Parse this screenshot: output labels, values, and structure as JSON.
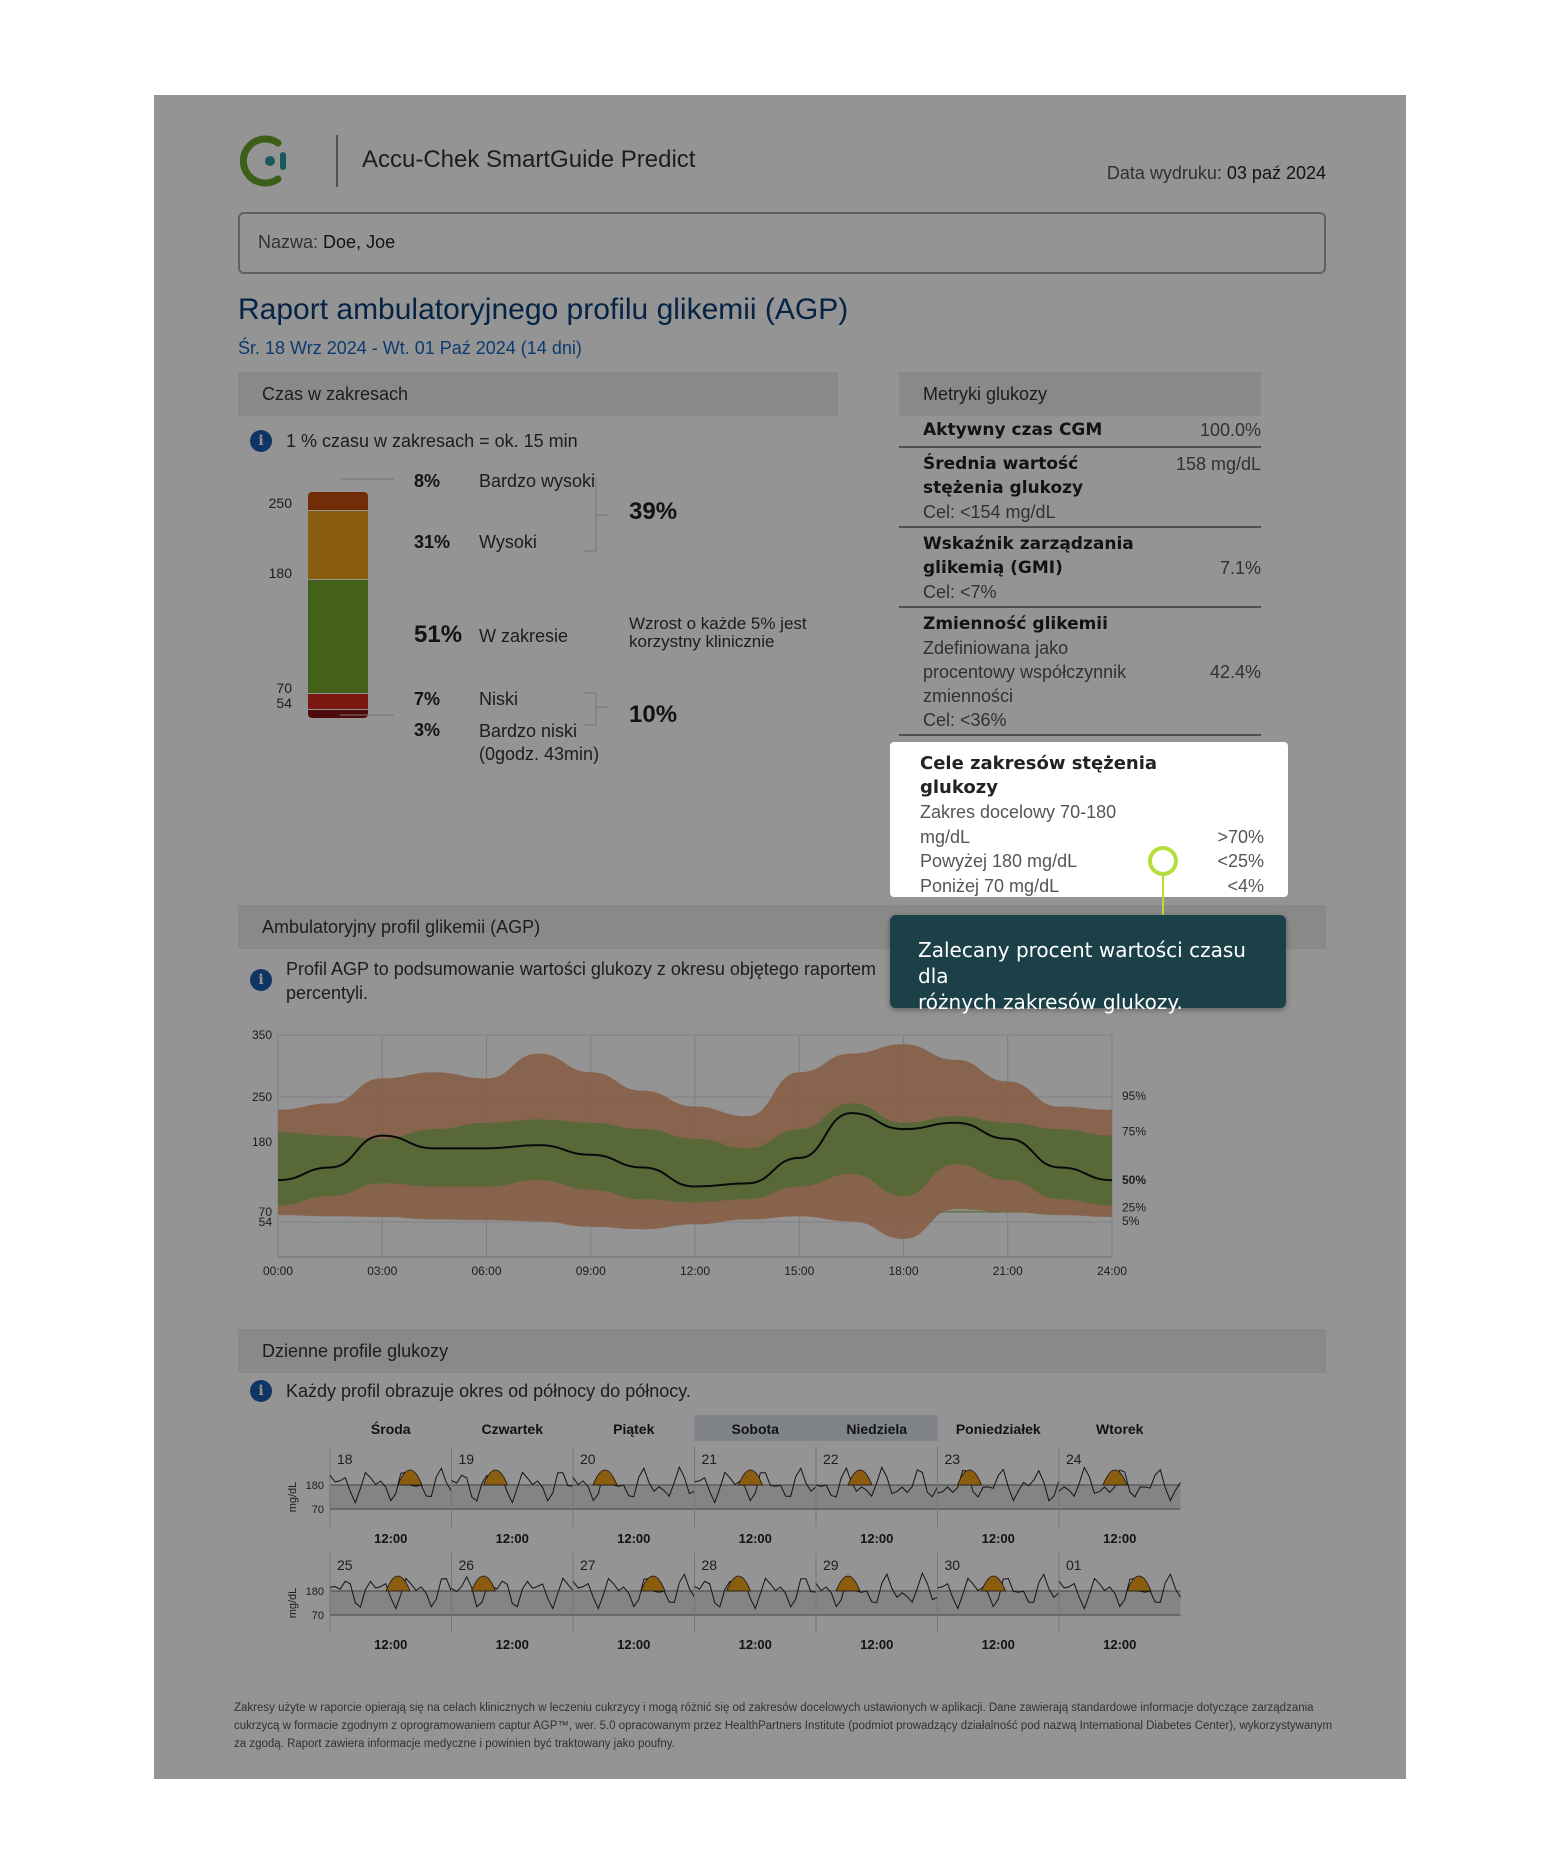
{
  "header": {
    "app_title": "Accu-Chek SmartGuide Predict",
    "print_date_label": "Data wydruku:",
    "print_date_value": "03 paź 2024",
    "name_label": "Nazwa:",
    "name_value": "Doe, Joe"
  },
  "report": {
    "title": "Raport ambulatoryjnego profilu glikemii (AGP)",
    "date_range": "Śr. 18 Wrz 2024 - Wt. 01 Paź 2024 (14 dni)"
  },
  "time_in_ranges": {
    "header": "Czas w zakresach",
    "note": "1 % czasu w zakresach = ok. 15 min",
    "axis_ticks": [
      "250",
      "180",
      "70",
      "54"
    ],
    "ranges": [
      {
        "pct": "8%",
        "label": "Bardzo wysoki",
        "value": 8,
        "color": "#c54e0e"
      },
      {
        "pct": "31%",
        "label": "Wysoki",
        "value": 31,
        "color": "#f0a11a"
      },
      {
        "pct": "51%",
        "label": "W zakresie",
        "value": 51,
        "color": "#75a82c"
      },
      {
        "pct": "7%",
        "label": "Niski",
        "value": 7,
        "color": "#d42a20"
      },
      {
        "pct": "3%",
        "label": "Bardzo niski",
        "value": 3,
        "color": "#8c1212"
      }
    ],
    "very_low_duration": "(0godz. 43min)",
    "group_high": "39%",
    "group_low": "10%",
    "target_note_line1": "Wzrost o każde 5% jest",
    "target_note_line2": "korzystny klinicznie"
  },
  "metrics": {
    "header": "Metryki glukozy",
    "active_cgm_label": "Aktywny czas CGM",
    "active_cgm_value": "100.0%",
    "mean_label_line1": "Średnia wartość",
    "mean_label_line2": "stężenia glukozy",
    "mean_value": "158 mg/dL",
    "mean_target": "Cel: <154 mg/dL",
    "gmi_label_line1": "Wskaźnik zarządzania",
    "gmi_label_line2": "glikemią (GMI)",
    "gmi_value": "7.1%",
    "gmi_target": "Cel: <7%",
    "cv_label": "Zmienność glikemii",
    "cv_desc_line1": "Zdefiniowana jako",
    "cv_desc_line2": "procentowy współczynnik",
    "cv_desc_line3": "zmienności",
    "cv_value": "42.4%",
    "cv_target": "Cel: <36%"
  },
  "targets_spotlight": {
    "title_line1": "Cele zakresów stężenia",
    "title_line2": "glukozy",
    "row1_label_line1": "Zakres docelowy 70-180",
    "row1_label_line2": "mg/dL",
    "row1_value": ">70%",
    "row2_label": "Powyżej 180 mg/dL",
    "row2_value": "<25%",
    "row3_label": "Poniżej 70 mg/dL",
    "row3_value": "<4%"
  },
  "tooltip": {
    "line1": "Zalecany procent wartości czasu dla",
    "line2": "różnych zakresów glukozy."
  },
  "agp": {
    "header": "Ambulatoryjny profil glikemii (AGP)",
    "note_line1": "Profil AGP to podsumowanie wartości glukozy z okresu objętego raportem",
    "note_line2": "percentyli.",
    "y_ticks": [
      "350",
      "250",
      "180",
      "70",
      "54"
    ],
    "x_ticks": [
      "00:00",
      "03:00",
      "06:00",
      "09:00",
      "12:00",
      "15:00",
      "18:00",
      "21:00",
      "24:00"
    ],
    "percentile_labels": [
      "95%",
      "75%",
      "50%",
      "25%",
      "5%"
    ]
  },
  "chart_data": {
    "type": "area",
    "x": [
      "00:00",
      "01:30",
      "03:00",
      "04:30",
      "06:00",
      "07:30",
      "09:00",
      "10:30",
      "12:00",
      "13:30",
      "15:00",
      "16:30",
      "18:00",
      "19:30",
      "21:00",
      "22:30",
      "24:00"
    ],
    "xlabel": "",
    "ylabel": "",
    "ylim": [
      0,
      350
    ],
    "series": [
      {
        "name": "95%",
        "values": [
          230,
          240,
          280,
          290,
          280,
          320,
          290,
          260,
          235,
          220,
          290,
          320,
          335,
          310,
          275,
          235,
          230
        ]
      },
      {
        "name": "75%",
        "values": [
          195,
          190,
          185,
          200,
          210,
          215,
          210,
          200,
          185,
          170,
          200,
          240,
          210,
          220,
          210,
          200,
          190
        ]
      },
      {
        "name": "50%",
        "values": [
          120,
          140,
          190,
          170,
          170,
          175,
          160,
          140,
          110,
          115,
          155,
          225,
          200,
          210,
          185,
          140,
          120
        ]
      },
      {
        "name": "25%",
        "values": [
          80,
          95,
          115,
          110,
          110,
          120,
          105,
          90,
          85,
          90,
          110,
          130,
          95,
          145,
          120,
          90,
          80
        ]
      },
      {
        "name": "5%",
        "values": [
          65,
          63,
          62,
          58,
          57,
          55,
          50,
          48,
          52,
          58,
          63,
          55,
          40,
          75,
          70,
          65,
          62
        ]
      }
    ],
    "target_band": [
      70,
      180
    ]
  },
  "daily": {
    "header": "Dzienne profile glukozy",
    "note": "Każdy profil obrazuje okres od północy do północy.",
    "weekdays": [
      "Środa",
      "Czwartek",
      "Piątek",
      "Sobota",
      "Niedziela",
      "Poniedziałek",
      "Wtorek"
    ],
    "week1_days": [
      "18",
      "19",
      "20",
      "21",
      "22",
      "23",
      "24"
    ],
    "week2_days": [
      "25",
      "26",
      "27",
      "28",
      "29",
      "30",
      "01"
    ],
    "noon_label": "12:00",
    "ylabel": "mg/dL",
    "y_ticks": [
      "180",
      "70"
    ]
  },
  "footer": {
    "text": "Zakresy użyte w raporcie opierają się na celach klinicznych w leczeniu cukrzycy i mogą różnić się od zakresów docelowych ustawionych w aplikacji. Dane zawierają standardowe informacje dotyczące zarządzania cukrzycą w formacie zgodnym z oprogramowaniem captur AGP™, wer. 5.0 opracowanym przez HealthPartners Institute (podmiot prowadzący działalność pod nazwą International Diabetes Center), wykorzystywanym za zgodą. Raport zawiera informacje medyczne i powinien być traktowany jako poufny."
  }
}
